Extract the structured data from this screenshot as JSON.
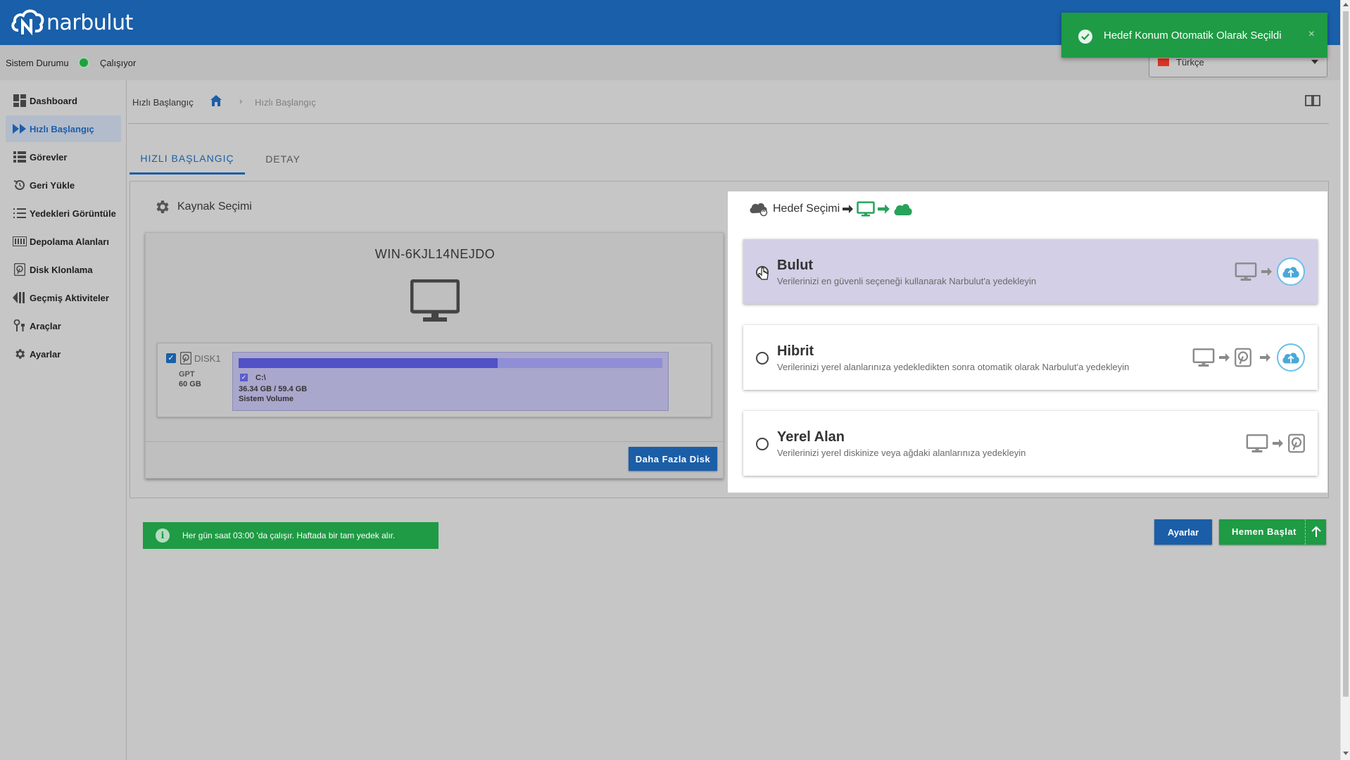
{
  "app": {
    "logo_text": "narbulut"
  },
  "status": {
    "label": "Sistem Durumu",
    "state": "Çalışıyor",
    "state_color": "#20a040"
  },
  "language": {
    "selected": "Türkçe"
  },
  "sidebar": {
    "items": [
      {
        "label": "Dashboard",
        "icon": "dashboard-icon",
        "active": false
      },
      {
        "label": "Hızlı Başlangıç",
        "icon": "fast-forward-icon",
        "active": true
      },
      {
        "label": "Görevler",
        "icon": "list-icon",
        "active": false
      },
      {
        "label": "Geri Yükle",
        "icon": "restore-icon",
        "active": false
      },
      {
        "label": "Yedekleri Görüntüle",
        "icon": "list-numbered-icon",
        "active": false
      },
      {
        "label": "Depolama Alanları",
        "icon": "storage-icon",
        "active": false
      },
      {
        "label": "Disk Klonlama",
        "icon": "disk-icon",
        "active": false
      },
      {
        "label": "Geçmiş Aktiviteler",
        "icon": "history-icon",
        "active": false
      },
      {
        "label": "Araçlar",
        "icon": "tools-icon",
        "active": false
      },
      {
        "label": "Ayarlar",
        "icon": "gear-icon",
        "active": false
      }
    ]
  },
  "breadcrumb": {
    "title": "Hızlı Başlangıç",
    "separator": "›",
    "current": "Hızlı Başlangıç"
  },
  "tabs": [
    {
      "label": "HIZLI BAŞLANGIÇ",
      "active": true
    },
    {
      "label": "DETAY",
      "active": false
    }
  ],
  "source": {
    "title": "Kaynak Seçimi",
    "host": "WIN-6KJL14NEJDO",
    "disk": {
      "name": "DISK1",
      "checked": true,
      "scheme": "GPT",
      "size": "60 GB",
      "partition": {
        "letter": "C:\\",
        "usage": "36.34 GB / 59.4 GB",
        "label": "Sistem Volume",
        "used_fraction": 0.612
      }
    },
    "more_disk_label": "Daha Fazla Disk"
  },
  "target": {
    "title": "Hedef Seçimi",
    "options": [
      {
        "title": "Bulut",
        "desc": "Verilerinizi en güvenli seçeneği kullanarak Narbulut'a yedekleyin",
        "selected": true
      },
      {
        "title": "Hibrit",
        "desc": "Verilerinizi yerel alanlarınıza yedekledikten sonra otomatik olarak Narbulut'a yedekleyin",
        "selected": false
      },
      {
        "title": "Yerel Alan",
        "desc": "Verilerinizi yerel diskinize veya ağdaki alanlarınıza yedekleyin",
        "selected": false
      }
    ]
  },
  "schedule_info": "Her gün saat 03:00 'da çalışır. Haftada bir tam yedek alır.",
  "buttons": {
    "settings": "Ayarlar",
    "start": "Hemen Başlat"
  },
  "toast": {
    "message": "Hedef Konum Otomatik Olarak Seçildi",
    "close": "×"
  },
  "colors": {
    "brand": "#195fa9",
    "success": "#1e9b44",
    "partition_fill": "#5151c8"
  }
}
